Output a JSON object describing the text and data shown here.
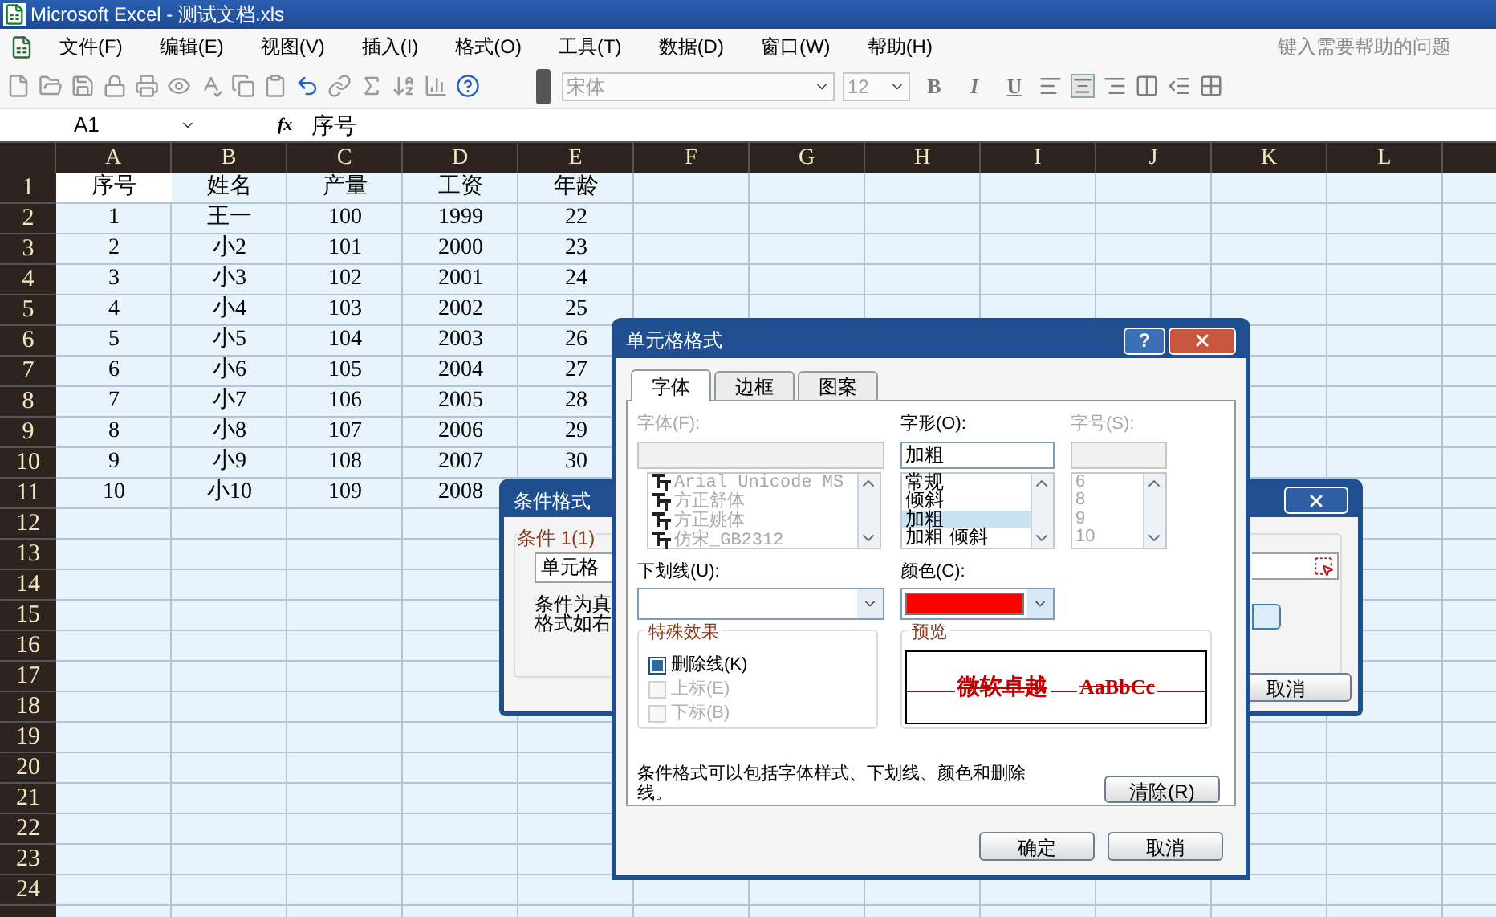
{
  "window": {
    "title": "Microsoft Excel - 测试文档.xls"
  },
  "menu": {
    "items": [
      "文件(F)",
      "编辑(E)",
      "视图(V)",
      "插入(I)",
      "格式(O)",
      "工具(T)",
      "数据(D)",
      "窗口(W)",
      "帮助(H)"
    ],
    "help_box": "键入需要帮助的问题"
  },
  "toolbar": {
    "font": "宋体",
    "size": "12",
    "style_buttons": [
      "B",
      "I",
      "U"
    ]
  },
  "formula_bar": {
    "cell_ref": "A1",
    "function_label": "fx",
    "content": "序号"
  },
  "sheet": {
    "columns": [
      "A",
      "B",
      "C",
      "D",
      "E",
      "F",
      "G",
      "H",
      "I",
      "J",
      "K",
      "L"
    ],
    "rows": [
      {
        "header": "1",
        "cells": [
          {
            "text": "序号",
            "selected": true
          },
          {
            "text": "姓名",
            "selected": false
          },
          {
            "text": "产量",
            "selected": false
          },
          {
            "text": "工资",
            "selected": false
          },
          {
            "text": "年龄",
            "selected": false
          }
        ]
      },
      {
        "header": "2",
        "cells": [
          {
            "text": "1",
            "selected": false
          },
          {
            "text": "王一",
            "selected": false
          },
          {
            "text": "100",
            "selected": false
          },
          {
            "text": "1999",
            "selected": false
          },
          {
            "text": "22",
            "selected": false
          }
        ]
      },
      {
        "header": "3",
        "cells": [
          {
            "text": "2",
            "selected": false
          },
          {
            "text": "小2",
            "selected": false
          },
          {
            "text": "101",
            "selected": false
          },
          {
            "text": "2000",
            "selected": false
          },
          {
            "text": "23",
            "selected": false
          }
        ]
      },
      {
        "header": "4",
        "cells": [
          {
            "text": "3",
            "selected": false
          },
          {
            "text": "小3",
            "selected": false
          },
          {
            "text": "102",
            "selected": false
          },
          {
            "text": "2001",
            "selected": false
          },
          {
            "text": "24",
            "selected": false
          }
        ]
      },
      {
        "header": "5",
        "cells": [
          {
            "text": "4",
            "selected": false
          },
          {
            "text": "小4",
            "selected": false
          },
          {
            "text": "103",
            "selected": false
          },
          {
            "text": "2002",
            "selected": false
          },
          {
            "text": "25",
            "selected": false
          }
        ]
      },
      {
        "header": "6",
        "cells": [
          {
            "text": "5",
            "selected": false
          },
          {
            "text": "小5",
            "selected": false
          },
          {
            "text": "104",
            "selected": false
          },
          {
            "text": "2003",
            "selected": false
          },
          {
            "text": "26",
            "selected": false
          }
        ]
      },
      {
        "header": "7",
        "cells": [
          {
            "text": "6",
            "selected": false
          },
          {
            "text": "小6",
            "selected": false
          },
          {
            "text": "105",
            "selected": false
          },
          {
            "text": "2004",
            "selected": false
          },
          {
            "text": "27",
            "selected": false
          }
        ]
      },
      {
        "header": "8",
        "cells": [
          {
            "text": "7",
            "selected": false
          },
          {
            "text": "小7",
            "selected": false
          },
          {
            "text": "106",
            "selected": false
          },
          {
            "text": "2005",
            "selected": false
          },
          {
            "text": "28",
            "selected": false
          }
        ]
      },
      {
        "header": "9",
        "cells": [
          {
            "text": "8",
            "selected": false
          },
          {
            "text": "小8",
            "selected": false
          },
          {
            "text": "107",
            "selected": false
          },
          {
            "text": "2006",
            "selected": false
          },
          {
            "text": "29",
            "selected": false
          }
        ]
      },
      {
        "header": "10",
        "cells": [
          {
            "text": "9",
            "selected": false
          },
          {
            "text": "小9",
            "selected": false
          },
          {
            "text": "108",
            "selected": false
          },
          {
            "text": "2007",
            "selected": false
          },
          {
            "text": "30",
            "selected": false
          }
        ]
      },
      {
        "header": "11",
        "cells": [
          {
            "text": "10",
            "selected": false
          },
          {
            "text": "小10",
            "selected": false
          },
          {
            "text": "109",
            "selected": false
          },
          {
            "text": "2008",
            "selected": false
          }
        ]
      },
      {
        "header": "12"
      },
      {
        "header": "13"
      },
      {
        "header": "14"
      },
      {
        "header": "15"
      },
      {
        "header": "16"
      },
      {
        "header": "17"
      },
      {
        "header": "18"
      },
      {
        "header": "19"
      },
      {
        "header": "20"
      },
      {
        "header": "21"
      },
      {
        "header": "22"
      },
      {
        "header": "23"
      },
      {
        "header": "24"
      }
    ]
  },
  "condition_dialog": {
    "title": "条件格式",
    "group_label": "条件 1(1)",
    "operator": "单元格",
    "description": [
      "条件为真",
      "格式如右"
    ],
    "cancel": "取消"
  },
  "format_dialog": {
    "title": "单元格格式",
    "help_button": "?",
    "tabs": [
      {
        "label": "字体",
        "selected": true
      },
      {
        "label": "边框",
        "selected": false
      },
      {
        "label": "图案",
        "selected": false
      }
    ],
    "font": {
      "label": "字体(F):",
      "disabled": true,
      "items": [
        "Arial Unicode MS",
        "方正舒体",
        "方正姚体",
        "仿宋_GB2312"
      ]
    },
    "style": {
      "label": "字形(O):",
      "value": "加粗",
      "items": [
        {
          "text": "常规",
          "selected": false
        },
        {
          "text": "倾斜",
          "selected": false
        },
        {
          "text": "加粗",
          "selected": true
        },
        {
          "text": "加粗 倾斜",
          "selected": false
        }
      ]
    },
    "size": {
      "label": "字号(S):",
      "disabled": true,
      "items": [
        "6",
        "8",
        "9",
        "10"
      ]
    },
    "underline": {
      "label": "下划线(U):"
    },
    "color": {
      "label": "颜色(C):",
      "color": "#ff0000"
    },
    "effects": {
      "title": "特殊效果",
      "items": [
        {
          "label": "删除线(K)",
          "checked": true,
          "disabled": false
        },
        {
          "label": "上标(E)",
          "checked": false,
          "disabled": true
        },
        {
          "label": "下标(B)",
          "checked": false,
          "disabled": true
        }
      ]
    },
    "preview": {
      "title": "预览",
      "samples": [
        "微软卓越",
        "AaBbCc"
      ]
    },
    "note": "条件格式可以包括字体样式、下划线、颜色和删除线。",
    "clear": "清除(R)",
    "ok": "确定",
    "cancel": "取消"
  }
}
